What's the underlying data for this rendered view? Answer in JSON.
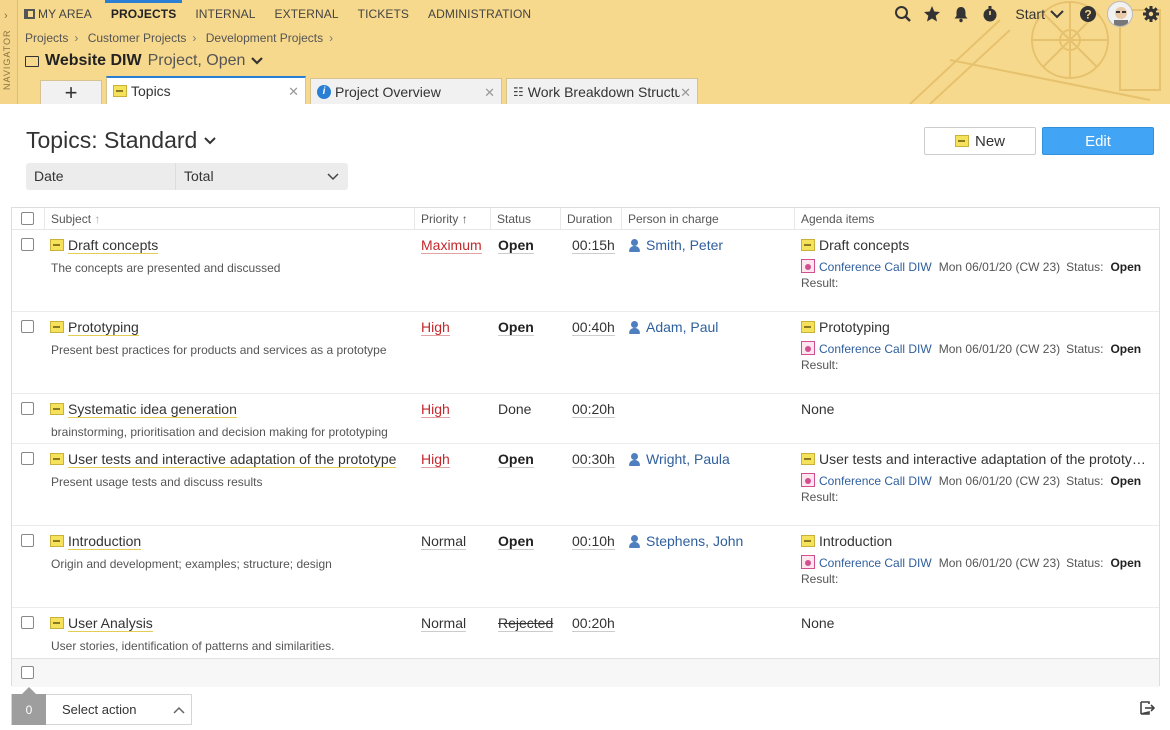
{
  "navigator": {
    "label": "NAVIGATOR"
  },
  "topnav": [
    {
      "label": "MY AREA"
    },
    {
      "label": "PROJECTS"
    },
    {
      "label": "INTERNAL"
    },
    {
      "label": "EXTERNAL"
    },
    {
      "label": "TICKETS"
    },
    {
      "label": "ADMINISTRATION"
    }
  ],
  "toolbar": {
    "start_label": "Start"
  },
  "breadcrumb": [
    "Projects",
    "Customer Projects",
    "Development Projects"
  ],
  "project": {
    "name": "Website DIW",
    "state": "Project, Open"
  },
  "tabs": [
    {
      "label": "Topics"
    },
    {
      "label": "Project Overview"
    },
    {
      "label": "Work Breakdown Structu"
    }
  ],
  "page": {
    "title": "Topics: Standard",
    "new_label": "New",
    "edit_label": "Edit"
  },
  "groupby": {
    "first": "Date",
    "second": "Total"
  },
  "columns": {
    "subject": "Subject",
    "priority": "Priority",
    "status": "Status",
    "duration": "Duration",
    "person": "Person in charge",
    "agenda": "Agenda items"
  },
  "agenda_labels": {
    "status": "Status:",
    "result": "Result:",
    "none": "None"
  },
  "rows": [
    {
      "subject": "Draft concepts",
      "description": "The concepts are presented and discussed",
      "priority": "Maximum",
      "status": "Open",
      "duration": "00:15h",
      "person": "Smith, Peter",
      "agenda_title": "Draft concepts",
      "meeting": "Conference Call DIW",
      "meeting_date": "Mon 06/01/20 (CW 23)",
      "meeting_status": "Open"
    },
    {
      "subject": "Prototyping",
      "description": "Present best practices for products and services as a prototype",
      "priority": "High",
      "status": "Open",
      "duration": "00:40h",
      "person": "Adam, Paul",
      "agenda_title": "Prototyping",
      "meeting": "Conference Call DIW",
      "meeting_date": "Mon 06/01/20 (CW 23)",
      "meeting_status": "Open"
    },
    {
      "subject": "Systematic idea generation",
      "description": "brainstorming, prioritisation and decision making for prototyping",
      "priority": "High",
      "status": "Done",
      "duration": "00:20h",
      "person": "",
      "agenda_title": "None"
    },
    {
      "subject": "User tests and interactive adaptation of the prototype",
      "description": "Present usage tests and discuss results",
      "priority": "High",
      "status": "Open",
      "duration": "00:30h",
      "person": "Wright, Paula",
      "agenda_title": "User tests and interactive adaptation of the prototy…",
      "meeting": "Conference Call DIW",
      "meeting_date": "Mon 06/01/20 (CW 23)",
      "meeting_status": "Open"
    },
    {
      "subject": "Introduction",
      "description": "Origin and development; examples; structure; design",
      "priority": "Normal",
      "status": "Open",
      "duration": "00:10h",
      "person": "Stephens, John",
      "agenda_title": "Introduction",
      "meeting": "Conference Call DIW",
      "meeting_date": "Mon 06/01/20 (CW 23)",
      "meeting_status": "Open"
    },
    {
      "subject": "User Analysis",
      "description": "User stories, identification of patterns and similarities.",
      "priority": "Normal",
      "status": "Rejected",
      "duration": "00:20h",
      "person": "",
      "agenda_title": "None"
    }
  ],
  "action_bar": {
    "count": "0",
    "label": "Select action"
  },
  "colors": {
    "header_bg": "#f7d98d",
    "accent_blue": "#42a4f5",
    "priority_red": "#c2282c",
    "link_blue": "#2f5f9e"
  },
  "icons": [
    "search-icon",
    "star-icon",
    "bell-icon",
    "stopwatch-icon",
    "chevron-down-icon",
    "help-icon",
    "gear-icon",
    "topic-icon",
    "meeting-icon",
    "person-icon",
    "export-icon"
  ]
}
